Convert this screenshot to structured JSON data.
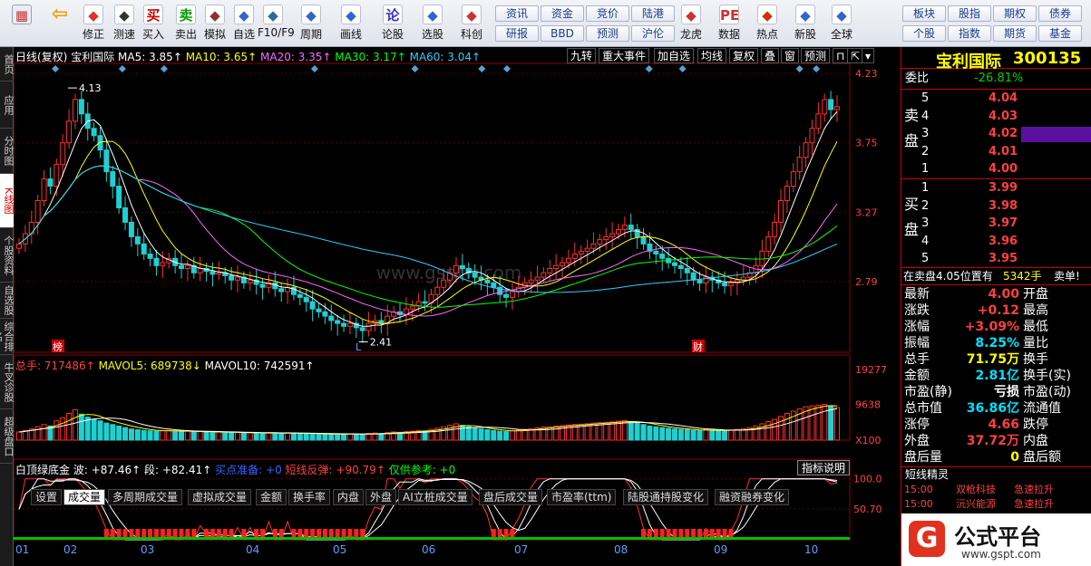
{
  "toolbar": {
    "buttons": [
      {
        "label": "修正",
        "icon": "up-down-arrows-icon"
      },
      {
        "label": "测速",
        "icon": "clock-icon"
      },
      {
        "label": "买入",
        "icon": "buy-icon",
        "glyph": "买"
      },
      {
        "label": "卖出",
        "icon": "sell-icon",
        "glyph": "卖"
      },
      {
        "label": "模拟",
        "icon": "hammer-icon"
      },
      {
        "label": "自选",
        "icon": "star-icon"
      },
      {
        "label": "F10/F9",
        "icon": "table-icon"
      },
      {
        "label": "周期",
        "icon": "clock-cycle-icon"
      },
      {
        "label": "画线",
        "icon": "pencil-icon"
      },
      {
        "label": "论股",
        "icon": "chat-icon",
        "glyph": "论"
      },
      {
        "label": "选股",
        "icon": "magnifier-chart-icon"
      },
      {
        "label": "科创",
        "icon": "chart-line-icon"
      },
      {
        "label": "龙虎",
        "icon": "dragon-icon"
      },
      {
        "label": "数据",
        "icon": "pe-icon",
        "glyph": "PE"
      },
      {
        "label": "热点",
        "icon": "hot-icon"
      },
      {
        "label": "新股",
        "icon": "new-stock-icon"
      },
      {
        "label": "全球",
        "icon": "globe-icon"
      }
    ],
    "quick_links": [
      "资讯",
      "资金",
      "竞价",
      "陆港",
      "研报",
      "BBD",
      "预测",
      "沪伦",
      "板块",
      "股指",
      "期权",
      "债券",
      "个股",
      "指数",
      "期货",
      "基金"
    ]
  },
  "left_tabs": [
    "首页",
    "应用",
    "分时图",
    "K线图",
    "个股资料",
    "自选股",
    "综合排名",
    "牛叉诊股",
    "超级盘口"
  ],
  "main": {
    "title_line": {
      "period": "日线(复权)",
      "name": "宝利国际",
      "ma5": "MA5: 3.85↑",
      "ma10": "MA10: 3.65↑",
      "ma20": "MA20: 3.35↑",
      "ma30": "MA30: 3.17↑",
      "ma60": "MA60: 3.04↑"
    },
    "chips": [
      "九转",
      "重大事件",
      "加自选",
      "均线",
      "复权",
      "叠",
      "窗",
      "预测"
    ],
    "markers": {
      "high": "4.13",
      "low": "2.41",
      "tag_rank": "榜",
      "tag_l": "L",
      "tag_fin": "财"
    },
    "watermark": "www.gsptw.com"
  },
  "volume": {
    "title": "总手: 717486↑",
    "mavol5": "MAVOL5: 689738↓",
    "mavol10": "MAVOL10: 742591↑",
    "axis_labels": [
      "19277",
      "9638",
      "X100"
    ],
    "tabs": [
      "设置",
      "成交量",
      "多周期成交量",
      "虚拟成交量",
      "金额",
      "换手率",
      "内盘",
      "外盘",
      "AI立桩成交量",
      "盘后成交量",
      "市盈率(ttm)",
      "陆股通持股变化",
      "融资融券变化"
    ]
  },
  "indicator": {
    "title": "白顶绿底金",
    "wave": "波: +87.46↑",
    "segment": "段: +82.41↑",
    "buy_ready": "买点准备: +0",
    "short_rebound": "短线反弹: +90.79↑",
    "ref_only": "仅供参考: +0",
    "help_label": "指标说明",
    "axis_labels": [
      "100.0",
      "50.70"
    ]
  },
  "time_axis": [
    "01",
    "02",
    "03",
    "04",
    "05",
    "06",
    "07",
    "08",
    "09",
    "10"
  ],
  "quote": {
    "name": "宝利国际",
    "code": "300135",
    "weibi_label": "委比",
    "weibi": "-26.81%",
    "sell_label": "卖盘",
    "buy_label": "买盘",
    "asks": [
      {
        "level": "5",
        "price": "4.04"
      },
      {
        "level": "4",
        "price": "4.03"
      },
      {
        "level": "3",
        "price": "4.02"
      },
      {
        "level": "2",
        "price": "4.01"
      },
      {
        "level": "1",
        "price": "4.00"
      }
    ],
    "bids": [
      {
        "level": "1",
        "price": "3.99"
      },
      {
        "level": "2",
        "price": "3.98"
      },
      {
        "level": "3",
        "price": "3.97"
      },
      {
        "level": "4",
        "price": "3.96"
      },
      {
        "level": "5",
        "price": "3.95"
      }
    ],
    "sell_note": "在卖盘4.05位置有",
    "sell_note_qty": "5342手",
    "sell_note_tag": "卖单!",
    "stats": [
      {
        "l1": "最新",
        "v1": "4.00",
        "c1": "red",
        "l2": "开盘",
        "v2": ""
      },
      {
        "l1": "涨跌",
        "v1": "+0.12",
        "c1": "red",
        "l2": "最高",
        "v2": ""
      },
      {
        "l1": "涨幅",
        "v1": "+3.09%",
        "c1": "red",
        "l2": "最低",
        "v2": ""
      },
      {
        "l1": "振幅",
        "v1": "8.25%",
        "c1": "cyan",
        "l2": "量比",
        "v2": ""
      },
      {
        "l1": "总手",
        "v1": "71.75万",
        "c1": "yellow",
        "l2": "换手",
        "v2": ""
      },
      {
        "l1": "金额",
        "v1": "2.81亿",
        "c1": "cyan",
        "l2": "换手(实)",
        "v2": ""
      },
      {
        "l1": "市盈(静)",
        "v1": "亏损",
        "c1": "white",
        "l2": "市盈(动)",
        "v2": ""
      },
      {
        "l1": "总市值",
        "v1": "36.86亿",
        "c1": "cyan",
        "l2": "流通值",
        "v2": ""
      },
      {
        "l1": "涨停",
        "v1": "4.66",
        "c1": "red",
        "l2": "跌停",
        "v2": ""
      },
      {
        "l1": "外盘",
        "v1": "37.72万",
        "c1": "red",
        "l2": "内盘",
        "v2": ""
      },
      {
        "l1": "盘后量",
        "v1": "0",
        "c1": "yellow",
        "l2": "盘后额",
        "v2": ""
      }
    ],
    "elves_title": "短线精灵",
    "elves": [
      {
        "time": "15:00",
        "name": "双枪科技",
        "event": "急速拉升"
      },
      {
        "time": "15:00",
        "name": "沅兴能源",
        "event": "急速拉升"
      }
    ],
    "brand": "公式平台",
    "brand_url": "www.gspt.com"
  },
  "chart_data": {
    "type": "candlestick",
    "title": "",
    "price_axis_labels": [
      "4.23",
      "3.75",
      "3.27",
      "2.79"
    ],
    "ylim": [
      2.3,
      4.3
    ],
    "x_months": [
      "01",
      "02",
      "03",
      "04",
      "05",
      "06",
      "07",
      "08",
      "09",
      "10"
    ],
    "annotations": [
      {
        "text": "4.13",
        "kind": "high"
      },
      {
        "text": "2.41",
        "kind": "low"
      }
    ],
    "series": [
      {
        "name": "MA5",
        "color": "#ffffff"
      },
      {
        "name": "MA10",
        "color": "#ffff00"
      },
      {
        "name": "MA20",
        "color": "#ff66ff"
      },
      {
        "name": "MA30",
        "color": "#00ff00"
      },
      {
        "name": "MA60",
        "color": "#33ccff"
      }
    ],
    "closes": [
      3.05,
      3.12,
      3.2,
      3.35,
      3.5,
      3.45,
      3.6,
      3.75,
      3.9,
      4.05,
      3.95,
      3.85,
      3.8,
      3.7,
      3.55,
      3.45,
      3.3,
      3.2,
      3.1,
      3.05,
      2.98,
      2.95,
      2.9,
      2.92,
      2.95,
      2.9,
      2.88,
      2.9,
      2.85,
      2.88,
      2.86,
      2.84,
      2.85,
      2.83,
      2.8,
      2.82,
      2.78,
      2.8,
      2.77,
      2.75,
      2.78,
      2.74,
      2.72,
      2.75,
      2.7,
      2.68,
      2.65,
      2.6,
      2.58,
      2.55,
      2.52,
      2.5,
      2.48,
      2.5,
      2.47,
      2.45,
      2.5,
      2.52,
      2.5,
      2.55,
      2.58,
      2.56,
      2.6,
      2.62,
      2.65,
      2.64,
      2.7,
      2.75,
      2.8,
      2.85,
      2.9,
      2.88,
      2.85,
      2.82,
      2.8,
      2.78,
      2.75,
      2.7,
      2.68,
      2.72,
      2.75,
      2.78,
      2.8,
      2.82,
      2.85,
      2.88,
      2.9,
      2.92,
      2.95,
      2.98,
      3.0,
      3.02,
      3.05,
      3.08,
      3.1,
      3.12,
      3.15,
      3.18,
      3.15,
      3.1,
      3.05,
      3.0,
      2.98,
      2.95,
      2.92,
      2.9,
      2.88,
      2.85,
      2.8,
      2.78,
      2.82,
      2.8,
      2.78,
      2.76,
      2.78,
      2.8,
      2.82,
      2.85,
      2.9,
      3.0,
      3.1,
      3.2,
      3.35,
      3.45,
      3.55,
      3.65,
      3.75,
      3.85,
      3.95,
      4.05,
      3.98,
      4.0
    ],
    "volumes": [
      2200,
      2600,
      3000,
      3600,
      4200,
      3800,
      5200,
      6000,
      7200,
      8200,
      7000,
      6200,
      5600,
      5200,
      4600,
      4200,
      3800,
      3400,
      3000,
      2800,
      2600,
      2500,
      2400,
      2500,
      2600,
      2400,
      2300,
      2400,
      2200,
      2300,
      2200,
      2100,
      2200,
      2100,
      2000,
      2100,
      1900,
      2000,
      1900,
      1800,
      2000,
      1900,
      1800,
      2000,
      1900,
      1800,
      1700,
      1700,
      1600,
      1600,
      1700,
      1600,
      1600,
      1700,
      1600,
      1600,
      1800,
      1900,
      1800,
      2000,
      2200,
      2100,
      2300,
      2400,
      2600,
      2500,
      2900,
      3200,
      3600,
      4000,
      4400,
      4000,
      3600,
      3200,
      3000,
      2800,
      2600,
      2400,
      2300,
      2500,
      2700,
      2900,
      3100,
      3300,
      3500,
      3600,
      3800,
      3900,
      4100,
      4200,
      4300,
      4400,
      4600,
      4700,
      4800,
      4900,
      5100,
      5300,
      5000,
      4600,
      4200,
      3800,
      3600,
      3400,
      3200,
      3000,
      2900,
      2800,
      2600,
      2500,
      2800,
      2700,
      2600,
      2500,
      2700,
      2900,
      3100,
      3400,
      3800,
      4400,
      5000,
      5600,
      6400,
      7200,
      7800,
      8400,
      9000,
      9200,
      9400,
      9638,
      9200,
      8800
    ],
    "volume_axis": [
      0,
      19277
    ]
  }
}
